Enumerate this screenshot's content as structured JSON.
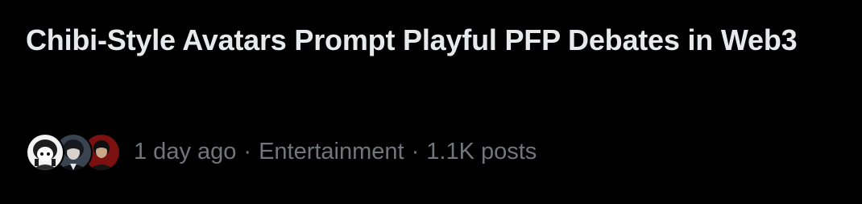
{
  "trend": {
    "title": "Chibi-Style Avatars Prompt Playful PFP Debates in Web3",
    "time_ago": "1 day ago",
    "category": "Entertainment",
    "post_count": "1.1K posts",
    "separator": "·"
  },
  "avatars": [
    {
      "icon": "chibi-avatar-icon",
      "colors": {
        "bg": "#f2f2f2",
        "hair": "#1d1d1d"
      }
    },
    {
      "icon": "anime-avatar-icon",
      "colors": {
        "bg": "#3a4450",
        "hair": "#161a1f"
      }
    },
    {
      "icon": "portrait-avatar-icon",
      "colors": {
        "bg": "#7a1010",
        "hair": "#0e0e0e"
      }
    }
  ],
  "colors": {
    "background": "#000000",
    "title": "#e7e9ea",
    "meta": "#71767b"
  }
}
